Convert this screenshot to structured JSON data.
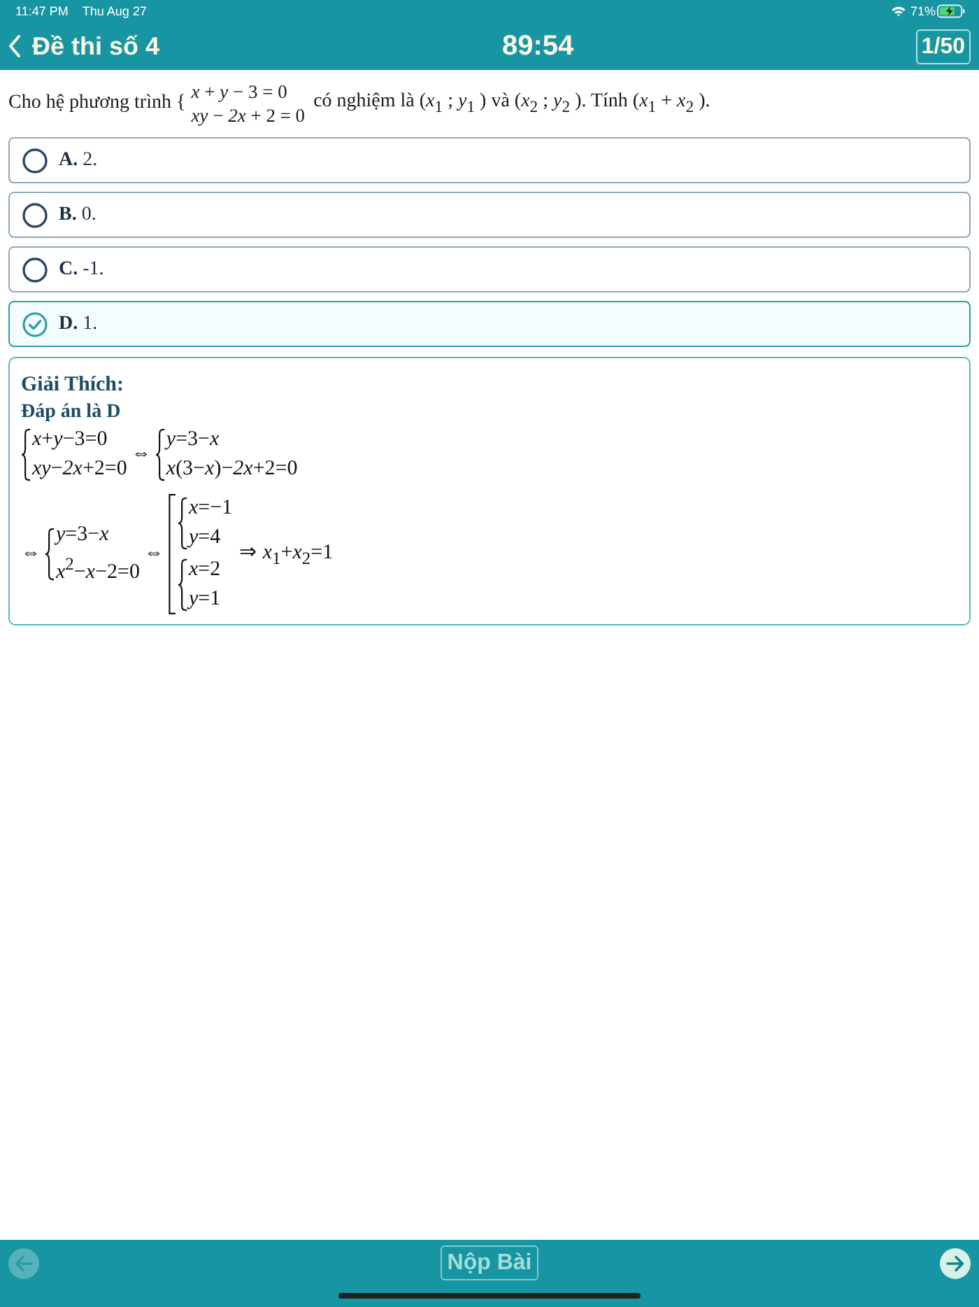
{
  "status_bar": {
    "time": "11:47 PM",
    "date": "Thu Aug 27",
    "battery": "71%"
  },
  "header": {
    "title": "Đề thi số 4",
    "timer": "89:54",
    "progress": "1/50"
  },
  "question": {
    "prefix": "Cho hệ phương trình {",
    "system": [
      "*x* + *y* − 3 = 0",
      "*xy* − *2x* + 2 = 0"
    ],
    "suffix": "có nghiệm là (*x*$_{1}$ ; *y*$_{1}$ ) và (*x*$_{2}$ ; *y*$_{2}$ ). Tính (*x*$_{1}$ + *x*$_{2}$ )."
  },
  "options": [
    {
      "label": "**A.** 2.",
      "selected": false
    },
    {
      "label": "**B.** 0.",
      "selected": false
    },
    {
      "label": "**C.** -1.",
      "selected": false
    },
    {
      "label": "**D.** 1.",
      "selected": true
    }
  ],
  "explanation": {
    "heading": "Giải Thích:",
    "answer": "Đáp án là D",
    "steps": [
      {
        "parts": [
          {
            "kind": "system",
            "lines": [
              "*x*+*y*−3=0",
              "*xy*−*2x*+2=0"
            ]
          },
          {
            "kind": "symbol",
            "text": "⇔"
          },
          {
            "kind": "system",
            "lines": [
              "*y*=3−*x*",
              "*x*(3−*x*)−*2x*+2=0"
            ]
          }
        ]
      },
      {
        "parts": [
          {
            "kind": "symbol",
            "text": "⇔"
          },
          {
            "kind": "system",
            "lines": [
              "*y*=3−*x*",
              "*x*$^{2}$−*x*−2=0"
            ]
          },
          {
            "kind": "symbol",
            "text": "⇔"
          },
          {
            "kind": "cases",
            "systems": [
              [
                "*x*=−1",
                "*y*=4"
              ],
              [
                "*x*=2",
                "*y*=1"
              ]
            ]
          },
          {
            "kind": "text",
            "text": "⇒ *x*$_{1}$+*x*$_{2}$=1"
          }
        ]
      }
    ]
  },
  "footer": {
    "prev": {
      "disabled": true
    },
    "submit": "Nộp Bài",
    "next": {
      "disabled": false
    }
  }
}
